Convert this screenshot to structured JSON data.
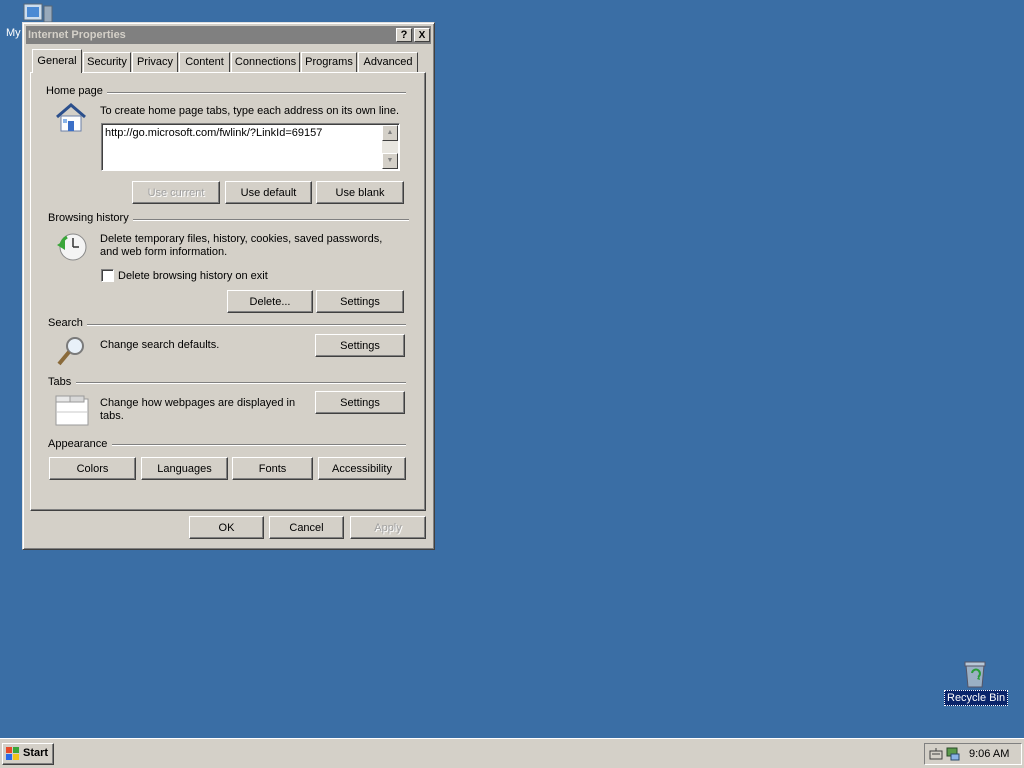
{
  "desktop": {
    "my_computer_label": "My",
    "recycle_bin_label": "Recycle Bin"
  },
  "window": {
    "title": "Internet Properties",
    "help_button": "?",
    "close_button": "X"
  },
  "tabs": [
    {
      "label": "General",
      "active": true
    },
    {
      "label": "Security"
    },
    {
      "label": "Privacy"
    },
    {
      "label": "Content"
    },
    {
      "label": "Connections"
    },
    {
      "label": "Programs"
    },
    {
      "label": "Advanced"
    }
  ],
  "home_page": {
    "title": "Home page",
    "instruction": "To create home page tabs, type each address on its own line.",
    "url": "http://go.microsoft.com/fwlink/?LinkId=69157",
    "use_current": "Use current",
    "use_default": "Use default",
    "use_blank": "Use blank"
  },
  "browsing_history": {
    "title": "Browsing history",
    "description": "Delete temporary files, history, cookies, saved passwords, and web form information.",
    "checkbox_label": "Delete browsing history on exit",
    "checked": false,
    "delete_button": "Delete...",
    "settings_button": "Settings"
  },
  "search": {
    "title": "Search",
    "description": "Change search defaults.",
    "settings_button": "Settings"
  },
  "tabs_section": {
    "title": "Tabs",
    "description": "Change how webpages are displayed in tabs.",
    "settings_button": "Settings"
  },
  "appearance": {
    "title": "Appearance",
    "colors": "Colors",
    "languages": "Languages",
    "fonts": "Fonts",
    "accessibility": "Accessibility"
  },
  "footer": {
    "ok": "OK",
    "cancel": "Cancel",
    "apply": "Apply"
  },
  "taskbar": {
    "start_label": "Start",
    "clock": "9:06 AM"
  },
  "colors": {
    "desktop": "#3a6ea5",
    "face": "#d4d0c8",
    "inactive_title": "#808080"
  }
}
